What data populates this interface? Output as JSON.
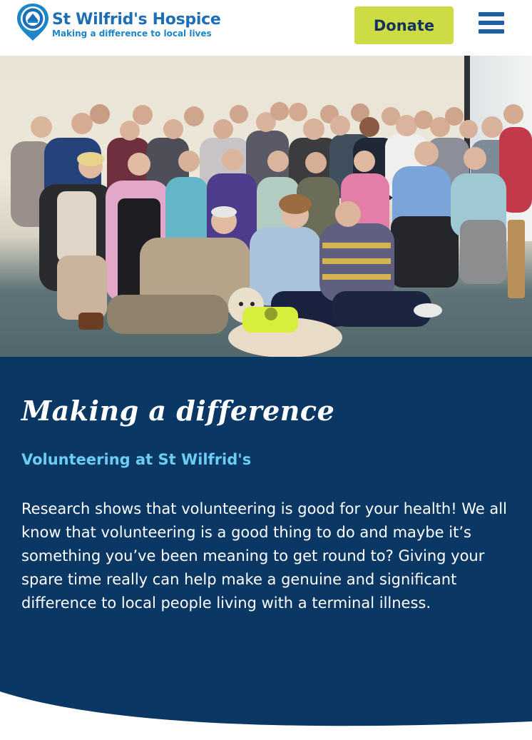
{
  "header": {
    "logo_title": "St Wilfrid's Hospice",
    "logo_tagline": "Making a difference to local lives",
    "donate_label": "Donate",
    "menu_icon": "hamburger-menu-icon"
  },
  "hero": {
    "image_description": "Group photo of volunteers with a dog"
  },
  "content": {
    "heading": "Making a difference",
    "subheading": "Volunteering at St Wilfrid's",
    "body": "Research shows that volunteering is good for your health! We all know that volunteering is a good thing to do and maybe it’s something you’ve been meaning to get round to? Giving your spare time really can help make a genuine and significant difference to local people living with a terminal illness."
  },
  "colors": {
    "brand_blue": "#1c6fb7",
    "donate_green": "#cddc45",
    "panel_navy": "#0b3765",
    "subheading_cyan": "#6ccdf2"
  }
}
